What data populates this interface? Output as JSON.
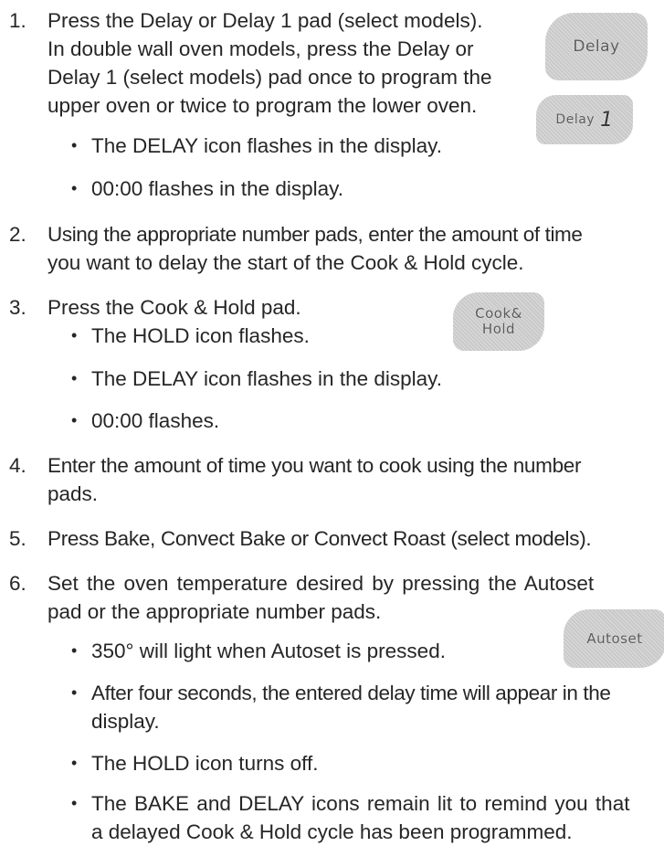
{
  "steps": {
    "s1": {
      "num": "1.",
      "lines": [
        "Press the Delay or Delay 1 pad (select models).",
        "In double wall oven models, press the Delay or",
        "Delay 1 (select models) pad once to program the",
        "upper oven or twice to program the lower oven."
      ],
      "bullets": [
        "The DELAY icon flashes in the display.",
        "00:00 flashes in the display."
      ]
    },
    "s2": {
      "num": "2.",
      "lines": [
        "Using the appropriate number pads, enter the amount of time",
        "you want to delay the start of the Cook & Hold cycle."
      ]
    },
    "s3": {
      "num": "3.",
      "lines": [
        "Press the Cook & Hold pad."
      ],
      "bullets": [
        "The HOLD icon flashes.",
        "The DELAY icon flashes in the display.",
        "00:00 flashes."
      ]
    },
    "s4": {
      "num": "4.",
      "lines": [
        "Enter the amount of time you want to cook using the number",
        "pads."
      ]
    },
    "s5": {
      "num": "5.",
      "lines": [
        "Press Bake, Convect Bake or Convect Roast (select models)."
      ]
    },
    "s6": {
      "num": "6.",
      "lines": [
        "Set the oven temperature desired by pressing the Autoset",
        "pad or the appropriate number pads."
      ],
      "bullets": [
        "350° will light when Autoset is pressed.",
        "After four seconds, the entered delay time will appear in the",
        "display.",
        "The HOLD icon turns off.",
        "The BAKE and DELAY icons remain lit to remind you that",
        "a delayed Cook & Hold cycle has been programmed."
      ]
    }
  },
  "bullet_glyph": "•",
  "pads": {
    "delay": "Delay",
    "delay1_text": "Delay",
    "delay1_num": "1",
    "cook_hold_line1": "Cook&",
    "cook_hold_line2": "Hold",
    "autoset": "Autoset"
  }
}
